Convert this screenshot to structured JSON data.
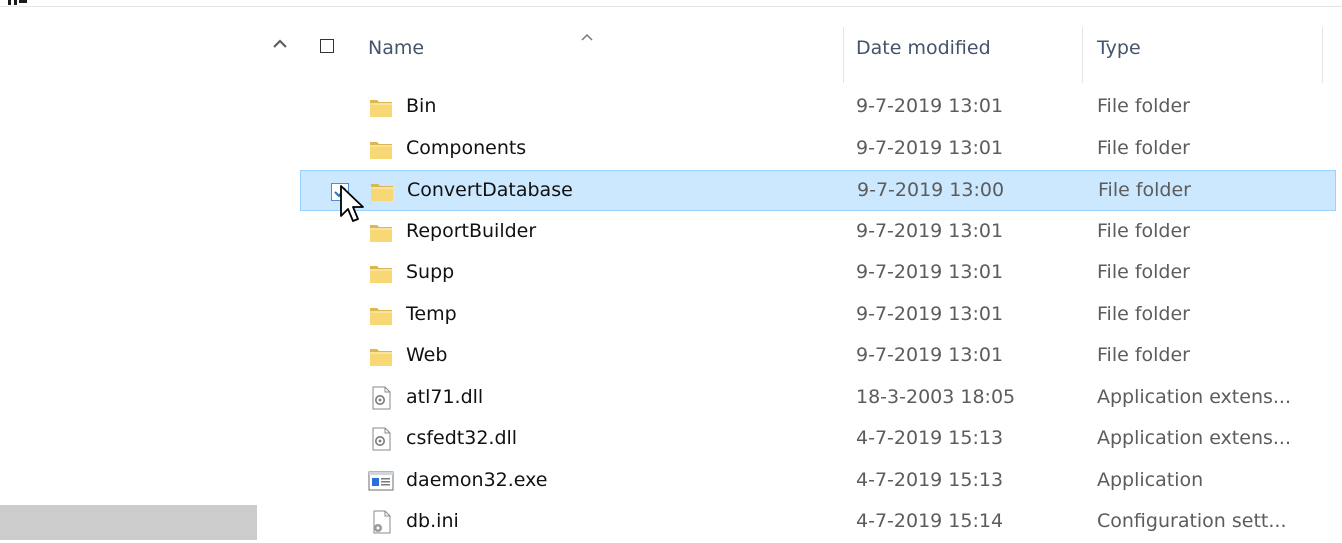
{
  "columns": {
    "name": "Name",
    "date_modified": "Date modified",
    "type": "Type",
    "sort_indicator": "ascending"
  },
  "files": [
    {
      "name": "Bin",
      "date": "9-7-2019 13:01",
      "type": "File folder",
      "icon": "folder-icon",
      "selected": false
    },
    {
      "name": "Components",
      "date": "9-7-2019 13:01",
      "type": "File folder",
      "icon": "folder-icon",
      "selected": false
    },
    {
      "name": "ConvertDatabase",
      "date": "9-7-2019 13:00",
      "type": "File folder",
      "icon": "folder-icon",
      "selected": true
    },
    {
      "name": "ReportBuilder",
      "date": "9-7-2019 13:01",
      "type": "File folder",
      "icon": "folder-icon",
      "selected": false
    },
    {
      "name": "Supp",
      "date": "9-7-2019 13:01",
      "type": "File folder",
      "icon": "folder-icon",
      "selected": false
    },
    {
      "name": "Temp",
      "date": "9-7-2019 13:01",
      "type": "File folder",
      "icon": "folder-icon",
      "selected": false
    },
    {
      "name": "Web",
      "date": "9-7-2019 13:01",
      "type": "File folder",
      "icon": "folder-icon",
      "selected": false
    },
    {
      "name": "atl71.dll",
      "date": "18-3-2003 18:05",
      "type": "Application extens...",
      "icon": "dll-file-icon",
      "selected": false
    },
    {
      "name": "csfedt32.dll",
      "date": "4-7-2019 15:13",
      "type": "Application extens...",
      "icon": "dll-file-icon",
      "selected": false
    },
    {
      "name": "daemon32.exe",
      "date": "4-7-2019 15:13",
      "type": "Application",
      "icon": "exe-file-icon",
      "selected": false
    },
    {
      "name": "db.ini",
      "date": "4-7-2019 15:14",
      "type": "Configuration sett...",
      "icon": "ini-file-icon",
      "selected": false
    }
  ],
  "colors": {
    "selection_bg": "#cce8ff",
    "selection_border": "#99d1ff",
    "folder": "#f8d775",
    "header_text": "#44546a",
    "nav_highlight": "#cccccc"
  }
}
